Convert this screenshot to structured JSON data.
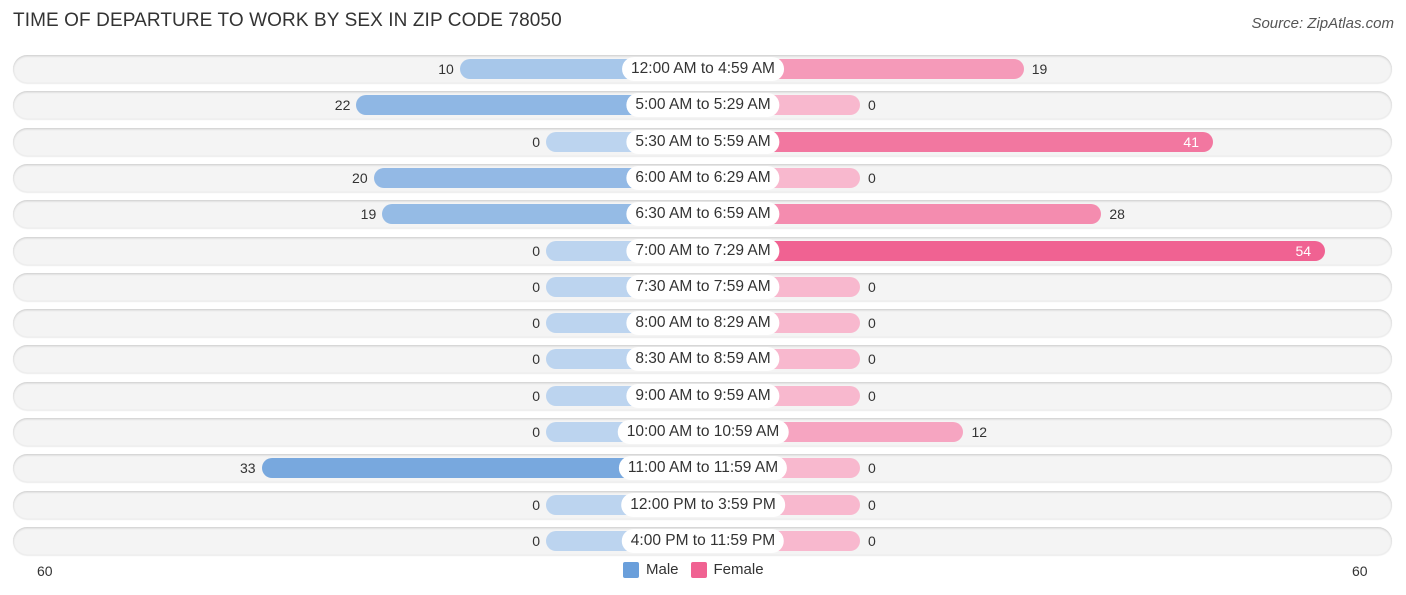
{
  "chart_data": {
    "type": "bar",
    "orientation": "horizontal-diverging",
    "title": "TIME OF DEPARTURE TO WORK BY SEX IN ZIP CODE 78050",
    "source": "Source: ZipAtlas.com",
    "categories": [
      "12:00 AM to 4:59 AM",
      "5:00 AM to 5:29 AM",
      "5:30 AM to 5:59 AM",
      "6:00 AM to 6:29 AM",
      "6:30 AM to 6:59 AM",
      "7:00 AM to 7:29 AM",
      "7:30 AM to 7:59 AM",
      "8:00 AM to 8:29 AM",
      "8:30 AM to 8:59 AM",
      "9:00 AM to 9:59 AM",
      "10:00 AM to 10:59 AM",
      "11:00 AM to 11:59 AM",
      "12:00 PM to 3:59 PM",
      "4:00 PM to 11:59 PM"
    ],
    "series": [
      {
        "name": "Male",
        "color": "#6a9fdb",
        "values": [
          10,
          22,
          0,
          20,
          19,
          0,
          0,
          0,
          0,
          0,
          0,
          33,
          0,
          0
        ]
      },
      {
        "name": "Female",
        "color": "#f06292",
        "values": [
          19,
          0,
          41,
          0,
          28,
          54,
          0,
          0,
          0,
          0,
          12,
          0,
          0,
          0
        ]
      }
    ],
    "axis": {
      "left_label": "60",
      "right_label": "60",
      "max": 60
    },
    "legend": {
      "position": "bottom-center",
      "items": [
        "Male",
        "Female"
      ]
    }
  }
}
